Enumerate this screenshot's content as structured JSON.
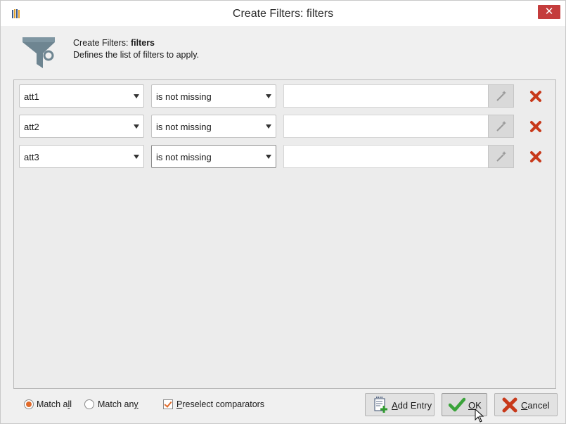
{
  "window": {
    "title": "Create Filters: filters",
    "close_glyph": "✕"
  },
  "header": {
    "line1_prefix": "Create Filters: ",
    "line1_bold": "filters",
    "line2": "Defines the list of filters to apply.",
    "icon": "funnel-icon"
  },
  "filters": [
    {
      "attribute": "att1",
      "operator": "is not missing",
      "value": ""
    },
    {
      "attribute": "att2",
      "operator": "is not missing",
      "value": ""
    },
    {
      "attribute": "att3",
      "operator": "is not missing",
      "value": ""
    }
  ],
  "footer": {
    "match_all": {
      "pre": "Match a",
      "ul": "l",
      "post": "l",
      "checked": true
    },
    "match_any": {
      "pre": "Match an",
      "ul": "y",
      "post": "",
      "checked": false
    },
    "preselect": {
      "ul": "P",
      "rest": "reselect comparators",
      "checked": true
    },
    "add_entry": {
      "ul": "A",
      "rest": "dd Entry"
    },
    "ok": {
      "ul": "O",
      "rest": "K"
    },
    "cancel": {
      "ul": "C",
      "rest": "ancel"
    }
  },
  "colors": {
    "accent": "#e06a2a",
    "delete": "#c8391a",
    "ok_check": "#3aa33a"
  }
}
